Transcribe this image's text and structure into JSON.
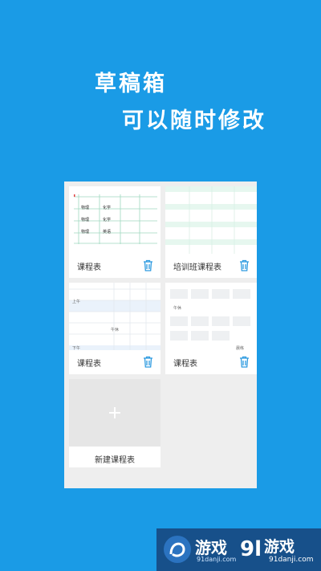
{
  "headline": {
    "line1": "草稿箱",
    "line2": "可以随时修改"
  },
  "drafts": [
    {
      "label": "课程表",
      "thumb_cells": [
        "物理",
        "化学",
        "物理",
        "化学",
        "物理",
        "英语"
      ]
    },
    {
      "label": "培训班课程表"
    },
    {
      "label": "课程表",
      "thumb_text": {
        "morning": "上午",
        "noon": "午休",
        "afternoon": "下午"
      }
    },
    {
      "label": "课程表",
      "thumb_text": {
        "top": "午休",
        "bottom": "晨练"
      }
    }
  ],
  "new_card": {
    "label": "新建课程表"
  },
  "colors": {
    "background": "#1a9be6",
    "panel": "#eeeeee",
    "grid_green": "#9fd8bf",
    "trash_blue": "#2e9be0"
  },
  "watermark": {
    "left_text": "游戏",
    "left_url": "91danji.com",
    "brand_text": "游戏",
    "brand_url": "91danji.com"
  }
}
